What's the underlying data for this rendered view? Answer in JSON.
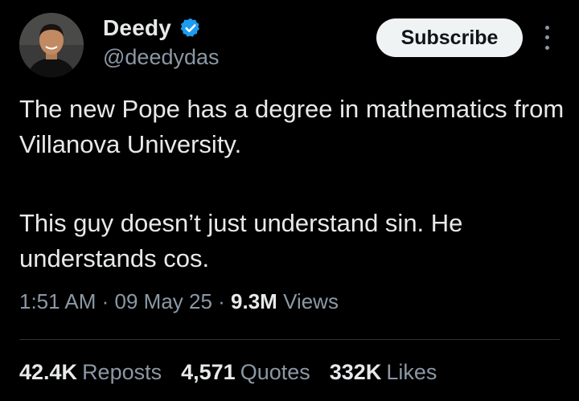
{
  "author": {
    "display_name": "Deedy",
    "handle": "@deedydas",
    "verified": true
  },
  "header": {
    "subscribe_label": "Subscribe",
    "more_icon": "more-vertical-icon"
  },
  "tweet": {
    "paragraphs": [
      "The new Pope has a degree in mathematics from Villanova University.",
      "This guy doesn’t just understand sin. He understands cos."
    ]
  },
  "meta": {
    "time": "1:51 AM",
    "separator": " · ",
    "date": "09 May 25",
    "views_count": "9.3M",
    "views_label": " Views"
  },
  "stats": {
    "reposts_count": "42.4K",
    "reposts_label": "Reposts",
    "quotes_count": "4,571",
    "quotes_label": "Quotes",
    "likes_count": "332K",
    "likes_label": "Likes"
  },
  "colors": {
    "background": "#000000",
    "primary_text": "#e7e9ea",
    "secondary_text": "#8b98a5",
    "verified_blue": "#1d9bf0",
    "button_bg": "#eff3f4"
  }
}
